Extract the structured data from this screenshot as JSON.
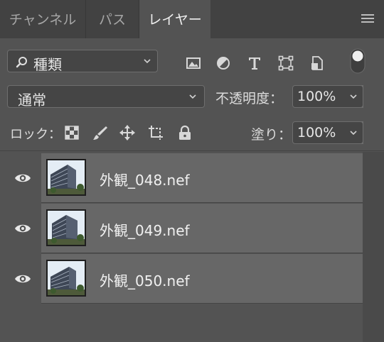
{
  "tabs": [
    {
      "label": "チャンネル",
      "active": false
    },
    {
      "label": "パス",
      "active": false
    },
    {
      "label": "レイヤー",
      "active": true
    }
  ],
  "filter": {
    "kind_label": "種類",
    "icons": [
      "image-filter-icon",
      "adjustment-filter-icon",
      "type-filter-icon",
      "shape-filter-icon",
      "smart-object-filter-icon"
    ]
  },
  "blend": {
    "mode": "通常",
    "opacity_label": "不透明度：",
    "opacity": "100%"
  },
  "lock": {
    "label": "ロック：",
    "fill_label": "塗り：",
    "fill": "100%"
  },
  "layers": [
    {
      "name": "外観_048.nef",
      "visible": true
    },
    {
      "name": "外観_049.nef",
      "visible": true
    },
    {
      "name": "外観_050.nef",
      "visible": true
    }
  ],
  "colors": {
    "panel": "#535353",
    "tabbar": "#424242",
    "layer_row": "#676767"
  }
}
